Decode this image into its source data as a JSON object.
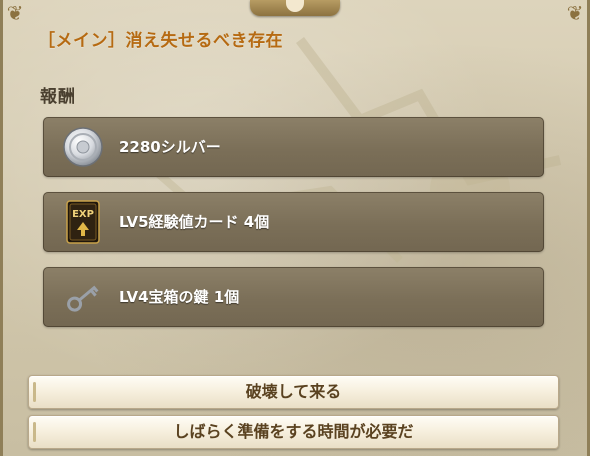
{
  "dialog": {
    "title": "［メイン］消え失せるべき存在",
    "reward_heading": "報酬"
  },
  "rewards": [
    {
      "label": "2280シルバー",
      "icon": "silver-coin-icon"
    },
    {
      "label": "LV5経験値カード 4個",
      "icon": "exp-card-icon"
    },
    {
      "label": "LV4宝箱の鍵 1個",
      "icon": "chest-key-icon"
    }
  ],
  "exp_card_text": "EXP",
  "buttons": {
    "destroy": "破壊して来る",
    "prepare": "しばらく準備をする時間が必要だ"
  },
  "colors": {
    "title": "#b66a12",
    "panel": "#7b6f58",
    "button_text": "#5a4220"
  }
}
